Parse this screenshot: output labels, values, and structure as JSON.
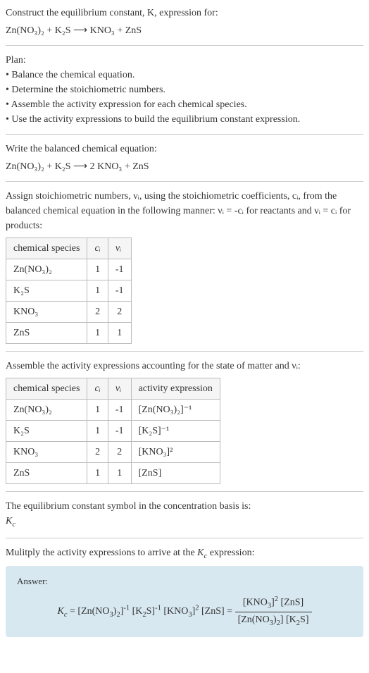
{
  "intro": {
    "line1": "Construct the equilibrium constant, K, expression for:",
    "eq": "Zn(NO₃)₂ + K₂S ⟶ KNO₃ + ZnS"
  },
  "plan": {
    "heading": "Plan:",
    "items": [
      "Balance the chemical equation.",
      "Determine the stoichiometric numbers.",
      "Assemble the activity expression for each chemical species.",
      "Use the activity expressions to build the equilibrium constant expression."
    ]
  },
  "balanced": {
    "heading": "Write the balanced chemical equation:",
    "eq": "Zn(NO₃)₂ + K₂S ⟶ 2 KNO₃ + ZnS"
  },
  "stoich": {
    "intro": "Assign stoichiometric numbers, νᵢ, using the stoichiometric coefficients, cᵢ, from the balanced chemical equation in the following manner: νᵢ = -cᵢ for reactants and νᵢ = cᵢ for products:",
    "headers": [
      "chemical species",
      "cᵢ",
      "νᵢ"
    ],
    "rows": [
      {
        "species": "Zn(NO₃)₂",
        "c": "1",
        "v": "-1"
      },
      {
        "species": "K₂S",
        "c": "1",
        "v": "-1"
      },
      {
        "species": "KNO₃",
        "c": "2",
        "v": "2"
      },
      {
        "species": "ZnS",
        "c": "1",
        "v": "1"
      }
    ]
  },
  "activity": {
    "intro": "Assemble the activity expressions accounting for the state of matter and νᵢ:",
    "headers": [
      "chemical species",
      "cᵢ",
      "νᵢ",
      "activity expression"
    ],
    "rows": [
      {
        "species": "Zn(NO₃)₂",
        "c": "1",
        "v": "-1",
        "expr": "[Zn(NO₃)₂]⁻¹"
      },
      {
        "species": "K₂S",
        "c": "1",
        "v": "-1",
        "expr": "[K₂S]⁻¹"
      },
      {
        "species": "KNO₃",
        "c": "2",
        "v": "2",
        "expr": "[KNO₃]²"
      },
      {
        "species": "ZnS",
        "c": "1",
        "v": "1",
        "expr": "[ZnS]"
      }
    ]
  },
  "symbol": {
    "line1": "The equilibrium constant symbol in the concentration basis is:",
    "line2": "K_c"
  },
  "multiply": {
    "heading": "Mulitply the activity expressions to arrive at the K_c expression:"
  },
  "answer": {
    "label": "Answer:",
    "lhs": "K_c = [Zn(NO₃)₂]⁻¹ [K₂S]⁻¹ [KNO₃]² [ZnS] = ",
    "num": "[KNO₃]² [ZnS]",
    "den": "[Zn(NO₃)₂] [K₂S]"
  }
}
